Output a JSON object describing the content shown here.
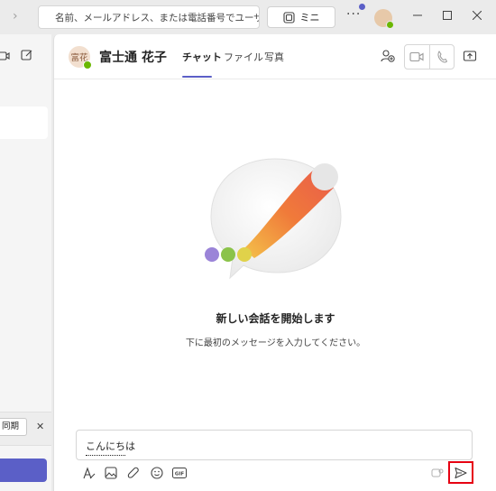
{
  "titlebar": {
    "search_placeholder": "名前、メールアドレス、または電話番号でユーザー",
    "mini_label": "ミニ",
    "more_label": "···"
  },
  "chat": {
    "contact_initials": "富花",
    "contact_name": "富士通 花子",
    "tabs": [
      {
        "label": "チャット",
        "active": true
      },
      {
        "label": "ファイル",
        "active": false
      },
      {
        "label": "写真",
        "active": false
      }
    ]
  },
  "left_pane": {
    "suggestion_chip": "同期"
  },
  "empty_state": {
    "title": "新しい会話を開始します",
    "subtitle": "下に最初のメッセージを入力してください。"
  },
  "compose": {
    "text": "こんにちは"
  },
  "colors": {
    "accent": "#5b5fc7",
    "presence_available": "#6bb700",
    "highlight_box": "#e60012"
  },
  "icons": {
    "search": "search-icon",
    "mini": "mini-window-icon",
    "add_people": "add-people-icon",
    "video": "video-call-icon",
    "phone": "audio-call-icon",
    "share": "share-screen-icon",
    "format": "format-icon",
    "image": "image-icon",
    "attach": "attach-icon",
    "emoji": "emoji-icon",
    "gif": "gif-icon",
    "loop": "loop-icon",
    "send": "send-icon"
  }
}
